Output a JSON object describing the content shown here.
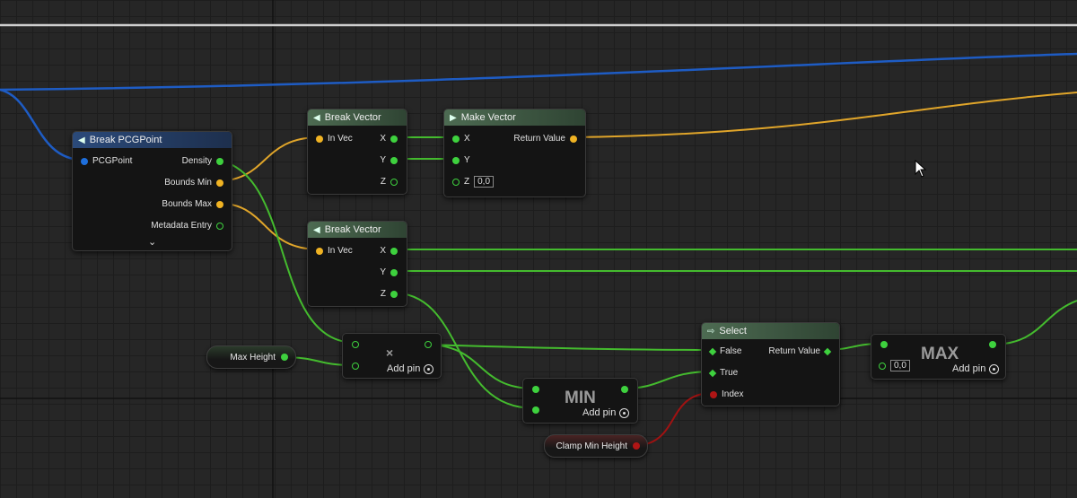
{
  "colors": {
    "exec_blue": "#1e6fdc",
    "float_green": "#3ed13e",
    "vector_yellow": "#f0b323",
    "bool_red": "#b01515",
    "header_blue": "#2b4a7a",
    "header_green": "#4d6b52"
  },
  "nodes": {
    "break_pcg_point": {
      "title": "Break PCGPoint",
      "icon": "break-struct-icon",
      "pins": {
        "pcgpoint": "PCGPoint",
        "density": "Density",
        "bounds_min": "Bounds Min",
        "bounds_max": "Bounds Max",
        "metadata_entry": "Metadata Entry"
      }
    },
    "break_vector_1": {
      "title": "Break Vector",
      "pins": {
        "in_vec": "In Vec",
        "x": "X",
        "y": "Y",
        "z": "Z"
      }
    },
    "break_vector_2": {
      "title": "Break Vector",
      "pins": {
        "in_vec": "In Vec",
        "x": "X",
        "y": "Y",
        "z": "Z"
      }
    },
    "make_vector": {
      "title": "Make Vector",
      "pins": {
        "x": "X",
        "y": "Y",
        "z": "Z",
        "z_value": "0,0",
        "return_value": "Return Value"
      }
    },
    "multiply": {
      "symbol": "×",
      "add_pin": "Add pin"
    },
    "min": {
      "label": "MIN",
      "add_pin": "Add pin"
    },
    "select": {
      "title": "Select",
      "pins": {
        "false": "False",
        "true": "True",
        "index": "Index",
        "return_value": "Return Value"
      }
    },
    "max": {
      "label": "MAX",
      "add_pin": "Add pin",
      "value": "0,0"
    }
  },
  "variables": {
    "max_height": "Max Height",
    "clamp_min_height": "Clamp Min Height"
  }
}
